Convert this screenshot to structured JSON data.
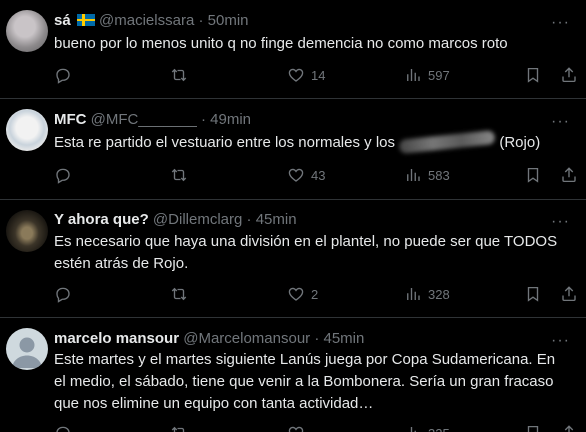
{
  "tweets": [
    {
      "name": "sá",
      "handle": "@macielssara",
      "time": "50min",
      "text": "bueno por lo menos unito q no finge demencia no como marcos roto",
      "replies": "",
      "retweets": "",
      "likes": "14",
      "views": "597",
      "flag": "sweden-flag"
    },
    {
      "name": "MFC",
      "handle": "@MFC_______",
      "time": "49min",
      "text_a": "Esta re partido el vestuario entre los normales y los",
      "text_b": "(Rojo)",
      "replies": "",
      "retweets": "",
      "likes": "43",
      "views": "583"
    },
    {
      "name": "Y ahora que?",
      "handle": "@Dillemclarg",
      "time": "45min",
      "text": "Es necesario que haya una división en el plantel, no puede ser que TODOS estén atrás de Rojo.",
      "replies": "",
      "retweets": "",
      "likes": "2",
      "views": "328"
    },
    {
      "name": "marcelo mansour",
      "handle": "@Marcelomansour",
      "time": "45min",
      "text": "Este martes y el martes siguiente Lanús juega por Copa Sudamericana. En el medio, el sábado, tiene que venir a la Bombonera. Sería un gran fracaso que nos elimine un equipo con tanta actividad…",
      "views": "325"
    }
  ],
  "separator": "·",
  "more_label": "···",
  "colors": {
    "background": "#000000",
    "text": "#e7e9ea",
    "muted": "#71767b",
    "divider": "#2f3336"
  }
}
